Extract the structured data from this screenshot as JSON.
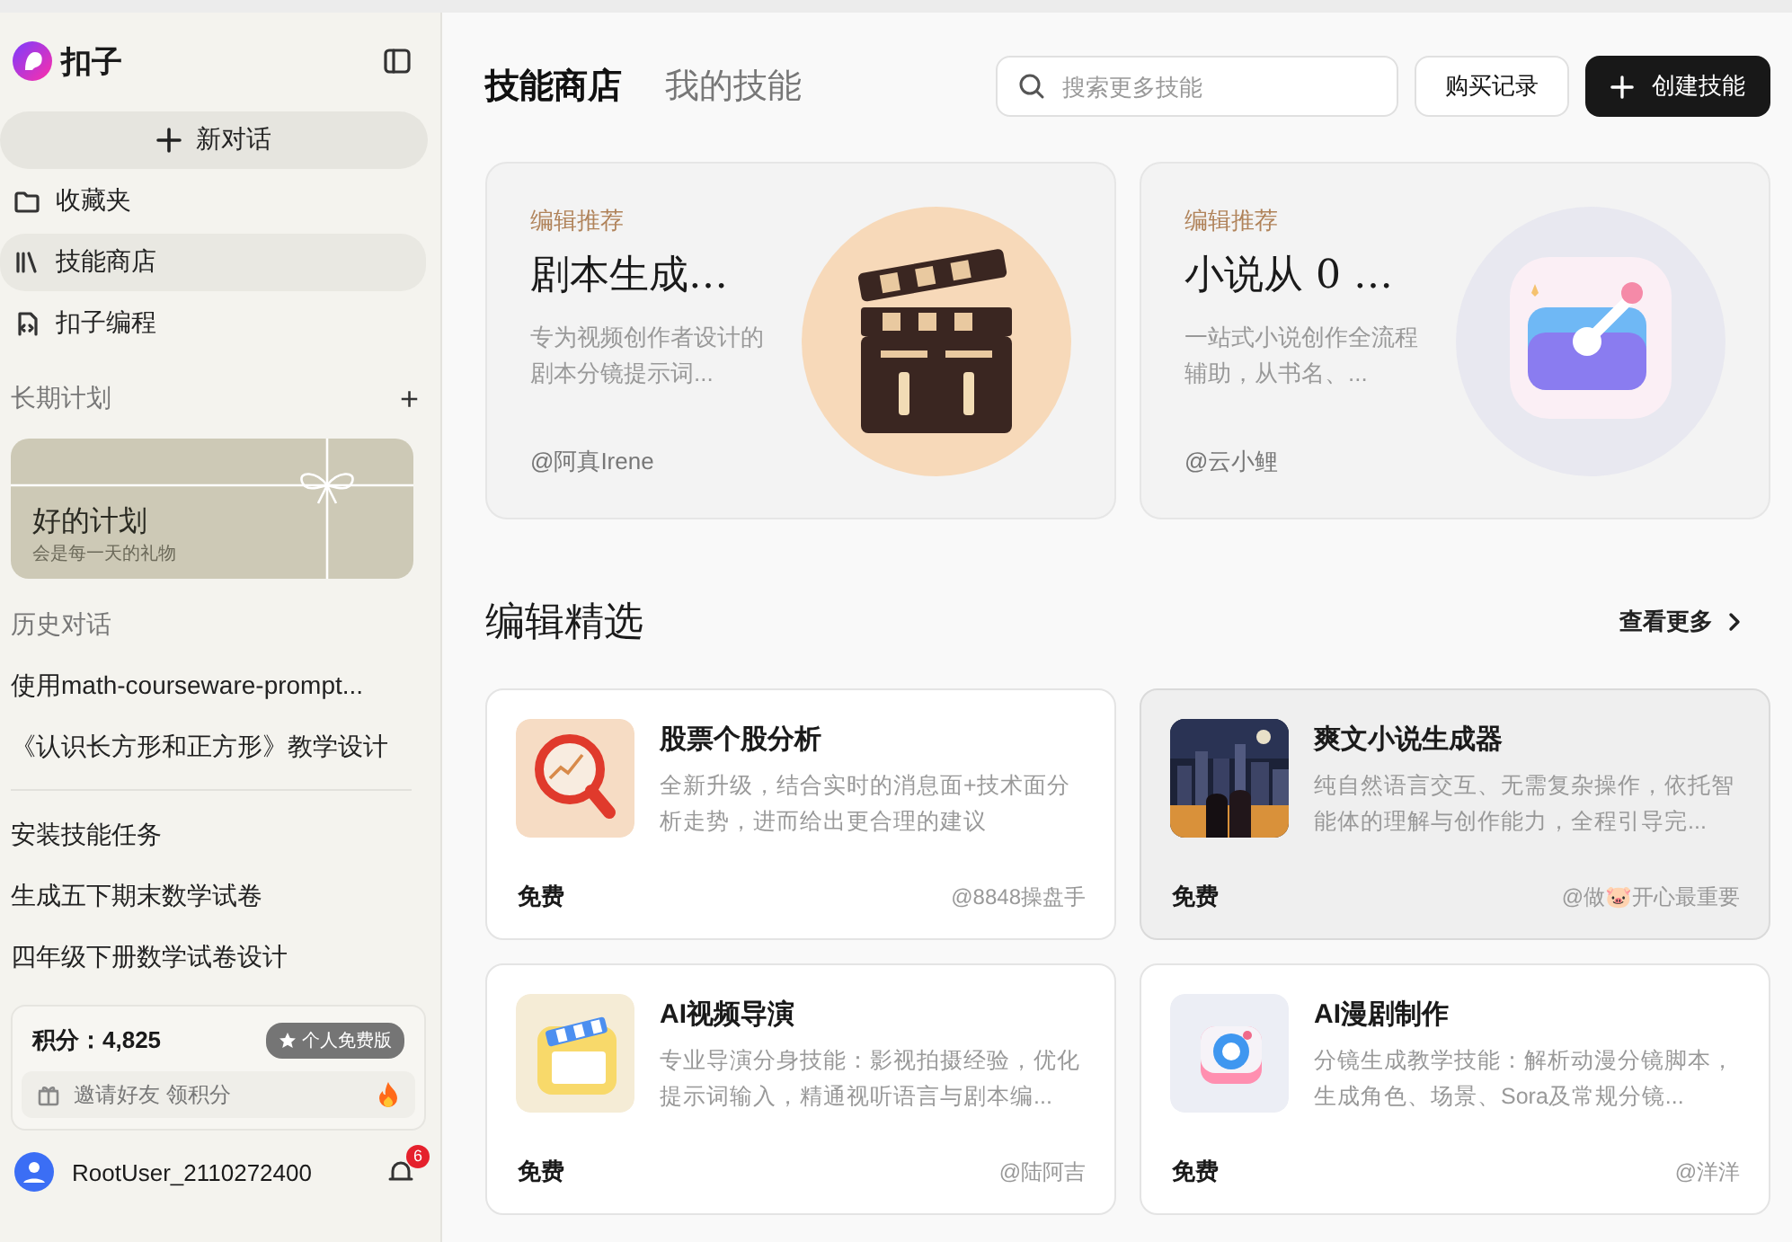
{
  "app": {
    "name": "扣子"
  },
  "sidebar": {
    "new_chat": "新对话",
    "nav": [
      {
        "label": "收藏夹",
        "selected": false
      },
      {
        "label": "技能商店",
        "selected": true
      },
      {
        "label": "扣子编程",
        "selected": false
      }
    ],
    "plans": {
      "heading": "长期计划",
      "add": "+",
      "card_title": "好的计划",
      "card_subtitle": "会是每一天的礼物"
    },
    "history": {
      "heading": "历史对话",
      "groups": [
        [
          "使用math-courseware-prompt...",
          "《认识长方形和正方形》教学设计"
        ],
        [
          "安装技能任务",
          "生成五下期末数学试卷",
          "四年级下册数学试卷设计"
        ]
      ]
    },
    "points": {
      "label": "积分：4,825",
      "badge": "个人免费版",
      "invite": "邀请好友 领积分"
    },
    "user": {
      "name": "RootUser_2110272400",
      "notifications": "6"
    }
  },
  "main": {
    "tabs": [
      {
        "label": "技能商店",
        "selected": true
      },
      {
        "label": "我的技能",
        "selected": false
      }
    ],
    "search": {
      "placeholder": "搜索更多技能"
    },
    "buttons": {
      "history": "购买记录",
      "create": "创建技能"
    },
    "featured": [
      {
        "tag": "编辑推荐",
        "title": "剧本生成…",
        "description": "专为视频创作者设计的剧本分镜提示词...",
        "author": "@阿真Irene"
      },
      {
        "tag": "编辑推荐",
        "title": "小说从 0 …",
        "description": "一站式小说创作全流程辅助，从书名、...",
        "author": "@云小鲤"
      }
    ],
    "section": {
      "title": "编辑精选",
      "more": "查看更多"
    },
    "skills": [
      {
        "title": "股票个股分析",
        "description": "全新升级，结合实时的消息面+技术面分析走势，进而给出更合理的建议",
        "price": "免费",
        "author": "@8848操盘手",
        "hovered": false
      },
      {
        "title": "爽文小说生成器",
        "description": "纯自然语言交互、无需复杂操作，依托智能体的理解与创作能力，全程引导完...",
        "price": "免费",
        "author": "@做🐷开心最重要",
        "hovered": true,
        "kind": "picture"
      },
      {
        "title": "AI视频导演",
        "description": "专业导演分身技能：影视拍摄经验，优化提示词输入，精通视听语言与剧本编...",
        "price": "免费",
        "author": "@陆阿吉",
        "hovered": false
      },
      {
        "title": "AI漫剧制作",
        "description": "分镜生成教学技能：解析动漫分镜脚本，生成角色、场景、Sora及常规分镜...",
        "price": "免费",
        "author": "@洋洋",
        "hovered": false
      }
    ]
  }
}
